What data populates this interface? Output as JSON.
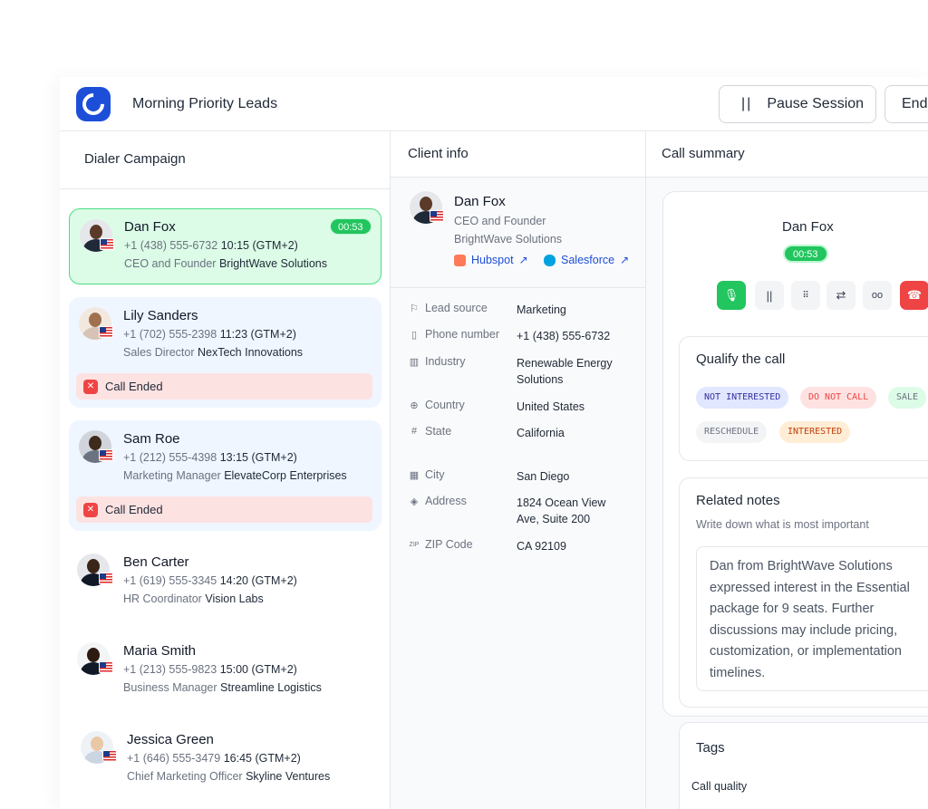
{
  "header": {
    "campaign_title": "Morning Priority Leads",
    "pause_label": "Pause Session",
    "end_label": "End"
  },
  "dialer": {
    "title": "Dialer Campaign",
    "leads": [
      {
        "name": "Dan Fox",
        "phone": "+1 (438) 555-6732",
        "time": "10:15 (GTM+2)",
        "role": "CEO and Founder",
        "company": "BrightWave Solutions",
        "status": "active",
        "timer": "00:53"
      },
      {
        "name": "Lily Sanders",
        "phone": "+1 (702) 555-2398",
        "time": "11:23 (GTM+2)",
        "role": "Sales Director",
        "company": "NexTech Innovations",
        "status": "ended",
        "status_label": "Call Ended"
      },
      {
        "name": "Sam Roe",
        "phone": "+1 (212) 555-4398",
        "time": "13:15 (GTM+2)",
        "role": "Marketing Manager",
        "company": "ElevateCorp Enterprises",
        "status": "ended",
        "status_label": "Call Ended"
      },
      {
        "name": "Ben Carter",
        "phone": "+1 (619) 555-3345",
        "time": "14:20 (GTM+2)",
        "role": "HR Coordinator",
        "company": "Vision Labs",
        "status": "idle"
      },
      {
        "name": "Maria Smith",
        "phone": "+1 (213) 555-9823",
        "time": "15:00 (GTM+2)",
        "role": "Business Manager",
        "company": "Streamline Logistics",
        "status": "idle"
      },
      {
        "name": "Jessica Green",
        "phone": "+1 (646) 555-3479",
        "time": "16:45 (GTM+2)",
        "role": "Chief Marketing Officer",
        "company": "Skyline Ventures",
        "status": "idle"
      }
    ]
  },
  "client": {
    "title": "Client info",
    "name": "Dan Fox",
    "role": "CEO and Founder",
    "company": "BrightWave Solutions",
    "crm_links": [
      {
        "label": "Hubspot",
        "icon": "hubspot-icon",
        "color": "#ff7a59"
      },
      {
        "label": "Salesforce",
        "icon": "salesforce-icon",
        "color": "#00a1e0"
      }
    ],
    "fields": [
      {
        "icon": "flag-icon",
        "label": "Lead source",
        "value": "Marketing"
      },
      {
        "icon": "phone-icon",
        "label": "Phone number",
        "value": "+1 (438) 555-6732"
      },
      {
        "icon": "building-icon",
        "label": "Industry",
        "value": "Renewable Energy Solutions"
      },
      {
        "icon": "globe-icon",
        "label": "Country",
        "value": "United States"
      },
      {
        "icon": "hash-icon",
        "label": "State",
        "value": "California"
      },
      {
        "icon": "city-icon",
        "label": "City",
        "value": "San Diego"
      },
      {
        "icon": "location-icon",
        "label": "Address",
        "value": "1824 Ocean View Ave, Suite 200"
      },
      {
        "icon": "zip-icon",
        "label": "ZIP Code",
        "value": "CA 92109"
      }
    ]
  },
  "summary": {
    "title": "Call summary",
    "name": "Dan Fox",
    "timer": "00:53",
    "controls": [
      "microphone-icon",
      "pause-icon",
      "keypad-icon",
      "transfer-icon",
      "voicemail-icon",
      "hangup-icon"
    ],
    "qualify": {
      "title": "Qualify the call",
      "options": [
        "NOT INTERESTED",
        "DO NOT CALL",
        "SALE",
        "RESCHEDULE",
        "INTERESTED"
      ]
    },
    "notes": {
      "title": "Related notes",
      "subtitle": "Write down what is most important",
      "text": "Dan from BrightWave Solutions expressed interest in the Essential package for 9 seats. Further discussions may include pricing, customization, or implementation timelines."
    },
    "tags": {
      "title": "Tags",
      "label": "Call quality"
    }
  },
  "colors": {
    "brand": "#1d4ed8",
    "active_green": "#22c55e",
    "ended_red": "#ef4444"
  }
}
